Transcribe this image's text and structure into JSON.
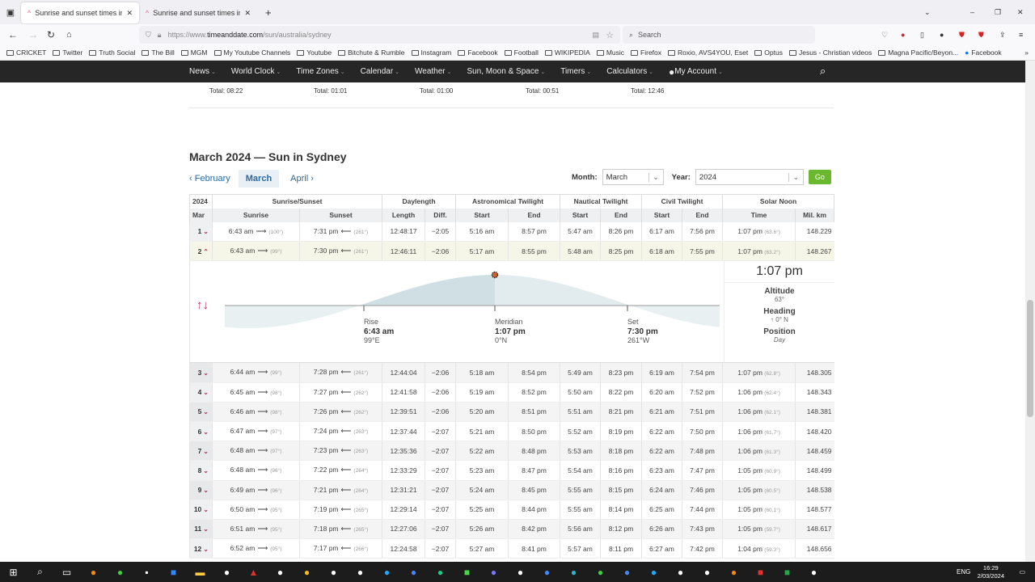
{
  "browser": {
    "tabs": [
      {
        "title": "Sunrise and sunset times in Syd",
        "active": true
      },
      {
        "title": "Sunrise and sunset times in Syd",
        "active": false
      }
    ],
    "url_prefix": "https://www.",
    "url_domain": "timeanddate.com",
    "url_path": "/sun/australia/sydney",
    "search_placeholder": "Search",
    "bookmarks": [
      "CRICKET",
      "Twitter",
      "Truth Social",
      "The Bill",
      "MGM",
      "My Youtube Channels",
      "Youtube",
      "Bitchute & Rumble",
      "Instagram",
      "Facebook",
      "Football",
      "WIKIPEDIA",
      "Music",
      "Firefox",
      "Roxio, AVS4YOU, Eset",
      "Optus",
      "Jesus - Christian videos",
      "Magna Pacific/Beyon...",
      "Facebook"
    ]
  },
  "site_nav": [
    "News",
    "World Clock",
    "Time Zones",
    "Calendar",
    "Weather",
    "Sun, Moon & Space",
    "Timers",
    "Calculators",
    "My Account"
  ],
  "totals": [
    "Total: 08:22",
    "Total: 01:01",
    "Total: 01:00",
    "Total: 00:51",
    "Total: 12:46"
  ],
  "title": "March 2024 — Sun in Sydney",
  "month_nav": {
    "prev": "February",
    "current": "March",
    "next": "April"
  },
  "selectors": {
    "month_label": "Month:",
    "month": "March",
    "year_label": "Year:",
    "year": "2024",
    "go": "Go"
  },
  "table": {
    "group_headers": [
      "2024",
      "Sunrise/Sunset",
      "Daylength",
      "Astronomical Twilight",
      "Nautical Twilight",
      "Civil Twilight",
      "Solar Noon"
    ],
    "headers": [
      "Mar",
      "Sunrise",
      "Sunset",
      "Length",
      "Diff.",
      "Start",
      "End",
      "Start",
      "End",
      "Start",
      "End",
      "Time",
      "Mil. km"
    ],
    "rows": [
      [
        "1",
        "6:43 am",
        "(100°)",
        "7:31 pm",
        "(261°)",
        "12:48:17",
        "−2:05",
        "5:16 am",
        "8:57 pm",
        "5:47 am",
        "8:26 pm",
        "6:17 am",
        "7:56 pm",
        "1:07 pm",
        "(63.6°)",
        "148.229"
      ],
      [
        "2",
        "6:43 am",
        "(99°)",
        "7:30 pm",
        "(261°)",
        "12:46:11",
        "−2:06",
        "5:17 am",
        "8:55 pm",
        "5:48 am",
        "8:25 pm",
        "6:18 am",
        "7:55 pm",
        "1:07 pm",
        "(63.2°)",
        "148.267"
      ],
      [
        "3",
        "6:44 am",
        "(99°)",
        "7:28 pm",
        "(261°)",
        "12:44:04",
        "−2:06",
        "5:18 am",
        "8:54 pm",
        "5:49 am",
        "8:23 pm",
        "6:19 am",
        "7:54 pm",
        "1:07 pm",
        "(62.8°)",
        "148.305"
      ],
      [
        "4",
        "6:45 am",
        "(98°)",
        "7:27 pm",
        "(262°)",
        "12:41:58",
        "−2:06",
        "5:19 am",
        "8:52 pm",
        "5:50 am",
        "8:22 pm",
        "6:20 am",
        "7:52 pm",
        "1:06 pm",
        "(62.4°)",
        "148.343"
      ],
      [
        "5",
        "6:46 am",
        "(98°)",
        "7:26 pm",
        "(262°)",
        "12:39:51",
        "−2:06",
        "5:20 am",
        "8:51 pm",
        "5:51 am",
        "8:21 pm",
        "6:21 am",
        "7:51 pm",
        "1:06 pm",
        "(62.1°)",
        "148.381"
      ],
      [
        "6",
        "6:47 am",
        "(97°)",
        "7:24 pm",
        "(263°)",
        "12:37:44",
        "−2:07",
        "5:21 am",
        "8:50 pm",
        "5:52 am",
        "8:19 pm",
        "6:22 am",
        "7:50 pm",
        "1:06 pm",
        "(61.7°)",
        "148.420"
      ],
      [
        "7",
        "6:48 am",
        "(97°)",
        "7:23 pm",
        "(263°)",
        "12:35:36",
        "−2:07",
        "5:22 am",
        "8:48 pm",
        "5:53 am",
        "8:18 pm",
        "6:22 am",
        "7:48 pm",
        "1:06 pm",
        "(61.3°)",
        "148.459"
      ],
      [
        "8",
        "6:48 am",
        "(96°)",
        "7:22 pm",
        "(264°)",
        "12:33:29",
        "−2:07",
        "5:23 am",
        "8:47 pm",
        "5:54 am",
        "8:16 pm",
        "6:23 am",
        "7:47 pm",
        "1:05 pm",
        "(60.9°)",
        "148.499"
      ],
      [
        "9",
        "6:49 am",
        "(96°)",
        "7:21 pm",
        "(264°)",
        "12:31:21",
        "−2:07",
        "5:24 am",
        "8:45 pm",
        "5:55 am",
        "8:15 pm",
        "6:24 am",
        "7:46 pm",
        "1:05 pm",
        "(60.5°)",
        "148.538"
      ],
      [
        "10",
        "6:50 am",
        "(95°)",
        "7:19 pm",
        "(265°)",
        "12:29:14",
        "−2:07",
        "5:25 am",
        "8:44 pm",
        "5:55 am",
        "8:14 pm",
        "6:25 am",
        "7:44 pm",
        "1:05 pm",
        "(60.1°)",
        "148.577"
      ],
      [
        "11",
        "6:51 am",
        "(95°)",
        "7:18 pm",
        "(265°)",
        "12:27:06",
        "−2:07",
        "5:26 am",
        "8:42 pm",
        "5:56 am",
        "8:12 pm",
        "6:26 am",
        "7:43 pm",
        "1:05 pm",
        "(59.7°)",
        "148.617"
      ],
      [
        "12",
        "6:52 am",
        "(95°)",
        "7:17 pm",
        "(266°)",
        "12:24:58",
        "−2:07",
        "5:27 am",
        "8:41 pm",
        "5:57 am",
        "8:11 pm",
        "6:27 am",
        "7:42 pm",
        "1:04 pm",
        "(59.3°)",
        "148.656"
      ]
    ],
    "expanded_row": "2"
  },
  "sun_graph": {
    "rise": {
      "label": "Rise",
      "time": "6:43 am",
      "dir": "99°E"
    },
    "meridian": {
      "label": "Meridian",
      "time": "1:07 pm",
      "dir": "0°N"
    },
    "set": {
      "label": "Set",
      "time": "7:30 pm",
      "dir": "261°W"
    },
    "current_time": "1:07 pm",
    "altitude_label": "Altitude",
    "altitude": "63°",
    "heading_label": "Heading",
    "heading": "0°   N",
    "position_label": "Position",
    "position": "Day",
    "colors": {
      "day_fill": "#cfdfe3",
      "curve": "#e2ecee",
      "accent": "#c4225b"
    }
  },
  "taskbar": {
    "time": "16:29",
    "date": "2/03/2024",
    "lang": "ENG"
  }
}
